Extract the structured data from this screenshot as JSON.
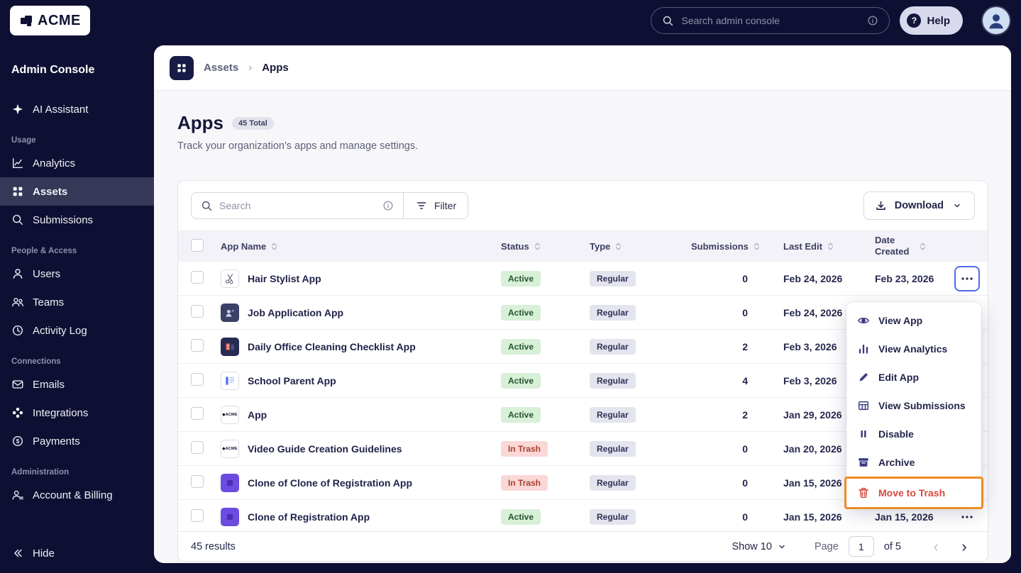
{
  "topbar": {
    "logo": "ACME",
    "search_placeholder": "Search admin console",
    "help": "Help"
  },
  "sidebar": {
    "title": "Admin Console",
    "assistant": "AI Assistant",
    "sections": [
      {
        "label": "Usage",
        "items": [
          {
            "label": "Analytics"
          },
          {
            "label": "Assets"
          },
          {
            "label": "Submissions"
          }
        ]
      },
      {
        "label": "People & Access",
        "items": [
          {
            "label": "Users"
          },
          {
            "label": "Teams"
          },
          {
            "label": "Activity Log"
          }
        ]
      },
      {
        "label": "Connections",
        "items": [
          {
            "label": "Emails"
          },
          {
            "label": "Integrations"
          },
          {
            "label": "Payments"
          }
        ]
      },
      {
        "label": "Administration",
        "items": [
          {
            "label": "Account & Billing"
          }
        ]
      }
    ],
    "hide": "Hide"
  },
  "breadcrumb": {
    "parent": "Assets",
    "current": "Apps"
  },
  "page": {
    "title": "Apps",
    "badge": "45 Total",
    "subtitle": "Track your organization's apps and manage settings."
  },
  "toolbar": {
    "search_placeholder": "Search",
    "filter": "Filter",
    "download": "Download"
  },
  "table": {
    "headers": {
      "name": "App Name",
      "status": "Status",
      "type": "Type",
      "submissions": "Submissions",
      "last_edit": "Last Edit",
      "date_created": "Date Created"
    },
    "rows": [
      {
        "name": "Hair Stylist App",
        "status": "Active",
        "type": "Regular",
        "submissions": "0",
        "last_edit": "Feb 24, 2026",
        "date_created": "Feb 23, 2026"
      },
      {
        "name": "Job Application App",
        "status": "Active",
        "type": "Regular",
        "submissions": "0",
        "last_edit": "Feb 24, 2026",
        "date_created": ""
      },
      {
        "name": "Daily Office Cleaning Checklist App",
        "status": "Active",
        "type": "Regular",
        "submissions": "2",
        "last_edit": "Feb 3, 2026",
        "date_created": ""
      },
      {
        "name": "School Parent App",
        "status": "Active",
        "type": "Regular",
        "submissions": "4",
        "last_edit": "Feb 3, 2026",
        "date_created": ""
      },
      {
        "name": "App",
        "status": "Active",
        "type": "Regular",
        "submissions": "2",
        "last_edit": "Jan 29, 2026",
        "date_created": ""
      },
      {
        "name": "Video Guide Creation Guidelines",
        "status": "In Trash",
        "type": "Regular",
        "submissions": "0",
        "last_edit": "Jan 20, 2026",
        "date_created": ""
      },
      {
        "name": "Clone of Clone of Registration App",
        "status": "In Trash",
        "type": "Regular",
        "submissions": "0",
        "last_edit": "Jan 15, 2026",
        "date_created": ""
      },
      {
        "name": "Clone of Registration App",
        "status": "Active",
        "type": "Regular",
        "submissions": "0",
        "last_edit": "Jan 15, 2026",
        "date_created": "Jan 15, 2026"
      }
    ]
  },
  "menu": {
    "items": [
      {
        "label": "View App"
      },
      {
        "label": "View Analytics"
      },
      {
        "label": "Edit App"
      },
      {
        "label": "View Submissions"
      },
      {
        "label": "Disable"
      },
      {
        "label": "Archive"
      },
      {
        "label": "Move to Trash"
      }
    ]
  },
  "footer": {
    "results": "45 results",
    "show": "Show 10",
    "page_label": "Page",
    "page_value": "1",
    "of": "of 5"
  },
  "colors": {
    "accent_orange": "#ef8b22",
    "accent_blue": "#4f6bed",
    "danger_red": "#d6493f",
    "navy": "#0e1033"
  }
}
